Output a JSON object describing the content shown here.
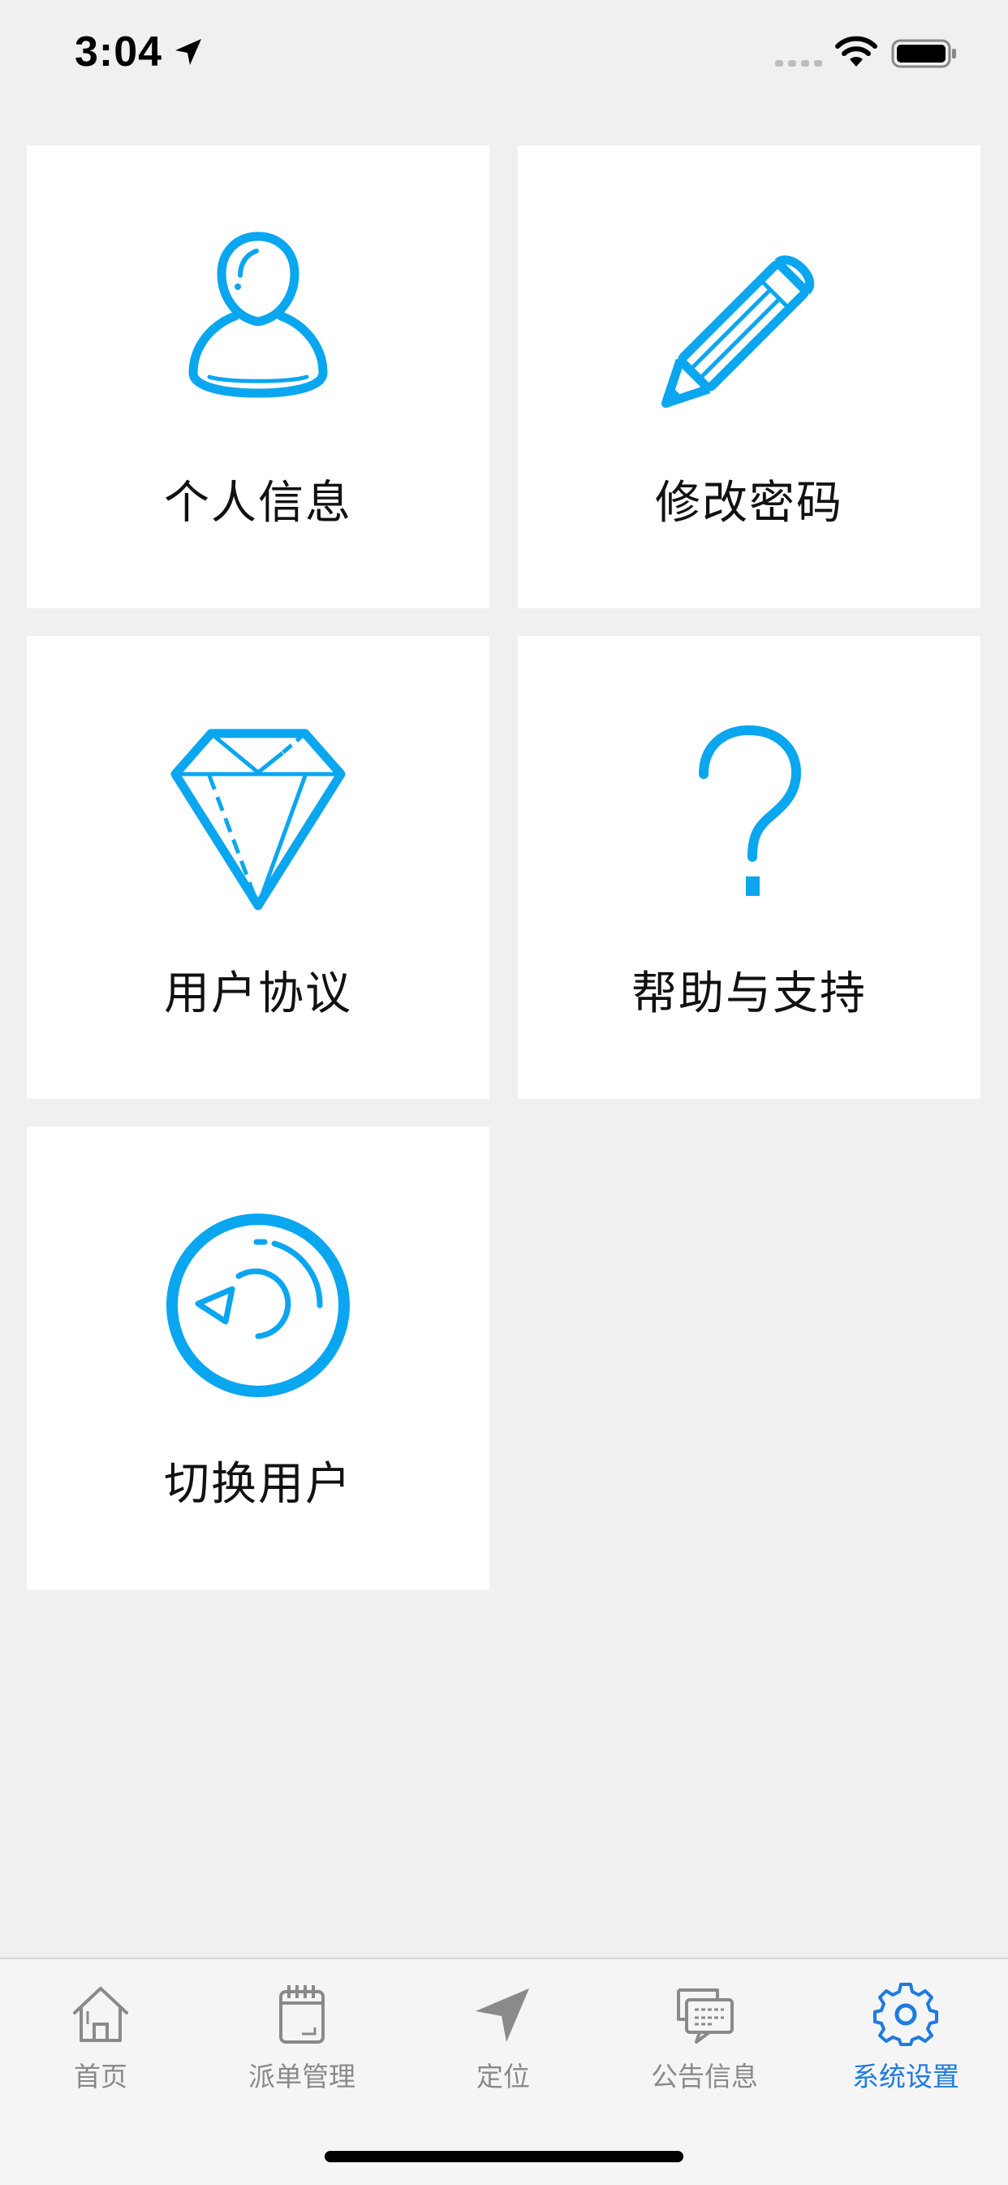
{
  "status_bar": {
    "time": "3:04"
  },
  "colors": {
    "accent": "#0aa6f0",
    "tab_active": "#1e7be0",
    "tab_inactive": "#8a8a8a",
    "background": "#f0f0f0",
    "tile": "#ffffff"
  },
  "menu": {
    "items": [
      {
        "label": "个人信息",
        "icon": "person-icon"
      },
      {
        "label": "修改密码",
        "icon": "pencil-icon"
      },
      {
        "label": "用户协议",
        "icon": "diamond-icon"
      },
      {
        "label": "帮助与支持",
        "icon": "question-icon"
      },
      {
        "label": "切换用户",
        "icon": "switch-user-icon"
      }
    ]
  },
  "tab_bar": {
    "active": "系统设置",
    "tabs": [
      {
        "label": "首页",
        "icon": "home-icon"
      },
      {
        "label": "派单管理",
        "icon": "notebook-icon"
      },
      {
        "label": "定位",
        "icon": "location-arrow-icon"
      },
      {
        "label": "公告信息",
        "icon": "chat-icon"
      },
      {
        "label": "系统设置",
        "icon": "gear-icon"
      }
    ]
  }
}
